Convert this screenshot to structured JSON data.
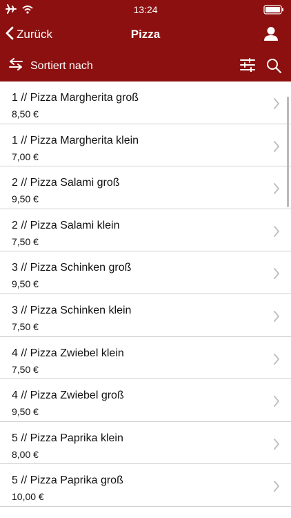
{
  "status_bar": {
    "time": "13:24"
  },
  "nav": {
    "back_label": "Zurück",
    "title": "Pizza"
  },
  "toolbar": {
    "sort_label": "Sortiert nach"
  },
  "items": [
    {
      "title": "1 // Pizza Margherita groß",
      "price": "8,50 €"
    },
    {
      "title": "1 // Pizza Margherita klein",
      "price": "7,00 €"
    },
    {
      "title": "2 // Pizza Salami groß",
      "price": "9,50 €"
    },
    {
      "title": "2 // Pizza Salami klein",
      "price": "7,50 €"
    },
    {
      "title": "3 // Pizza Schinken groß",
      "price": "9,50 €"
    },
    {
      "title": "3 // Pizza Schinken klein",
      "price": "7,50 €"
    },
    {
      "title": "4 // Pizza Zwiebel klein",
      "price": "7,50 €"
    },
    {
      "title": "4 // Pizza Zwiebel groß",
      "price": "9,50 €"
    },
    {
      "title": "5 // Pizza Paprika klein",
      "price": "8,00 €"
    },
    {
      "title": "5 // Pizza Paprika groß",
      "price": "10,00 €"
    }
  ],
  "colors": {
    "brand": "#8c1010",
    "divider": "#cfcfcf",
    "chevron": "#c0c0c0"
  },
  "icons": [
    "airplane-icon",
    "wifi-icon",
    "battery-icon",
    "chevron-left-icon",
    "user-icon",
    "swap-arrows-icon",
    "filter-sliders-icon",
    "search-icon",
    "chevron-right-icon"
  ]
}
